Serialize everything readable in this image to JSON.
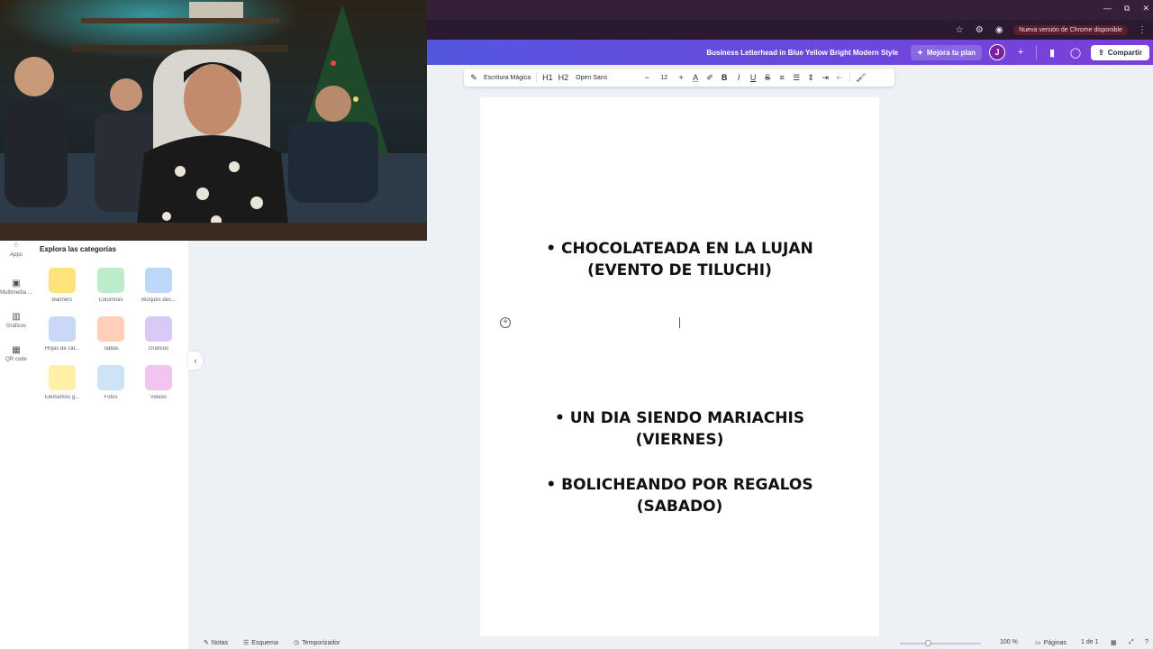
{
  "browser": {
    "update_chip": "Nueva versión de Chrome disponible"
  },
  "header": {
    "doc_title": "Business Letterhead in Blue Yellow Bright Modern Style",
    "upgrade_label": "Mejora tu plan",
    "avatar_initial": "J",
    "share_label": "Compartir"
  },
  "toolbar": {
    "magic_label": "Escritura Mágica",
    "h1": "H1",
    "h2": "H2",
    "font": "Open Sans",
    "minus": "−",
    "size": "12",
    "plus": "+",
    "bold": "B",
    "italic": "I",
    "underline": "U",
    "strike": "S"
  },
  "rail": {
    "items": [
      {
        "label": "Apps",
        "icon": "apps-icon"
      },
      {
        "label": "Multimedia ...",
        "icon": "media-icon"
      },
      {
        "label": "Gráficos",
        "icon": "chart-icon"
      },
      {
        "label": "QR code",
        "icon": "qr-icon"
      }
    ]
  },
  "panel": {
    "title": "Explora las categorías",
    "categories": [
      {
        "label": "Banners",
        "color": "#ffe27a"
      },
      {
        "label": "Columnas",
        "color": "#bdeccb"
      },
      {
        "label": "Bloques des...",
        "color": "#bcd7f7"
      },
      {
        "label": "Hojas de cál...",
        "color": "#c9d8f6"
      },
      {
        "label": "Tablas",
        "color": "#ffcfb8"
      },
      {
        "label": "Gráficos",
        "color": "#d9c9f7"
      },
      {
        "label": "Elementos g...",
        "color": "#fff0a8"
      },
      {
        "label": "Fotos",
        "color": "#cfe3f7"
      },
      {
        "label": "Videos",
        "color": "#f3c4f0"
      }
    ]
  },
  "document": {
    "line1a": "• CHOCOLATEADA EN LA LUJAN",
    "line1b": "(EVENTO DE TILUCHI)",
    "line2a": "• UN DIA SIENDO MARIACHIS",
    "line2b": "(VIERNES)",
    "line3a": "• BOLICHEANDO POR REGALOS",
    "line3b": "(SABADO)"
  },
  "footer": {
    "notes": "Notas",
    "outline": "Esquema",
    "timer": "Temporizador",
    "zoom": "100 %",
    "pages_label": "Páginas",
    "page_count": "1 de 1"
  }
}
